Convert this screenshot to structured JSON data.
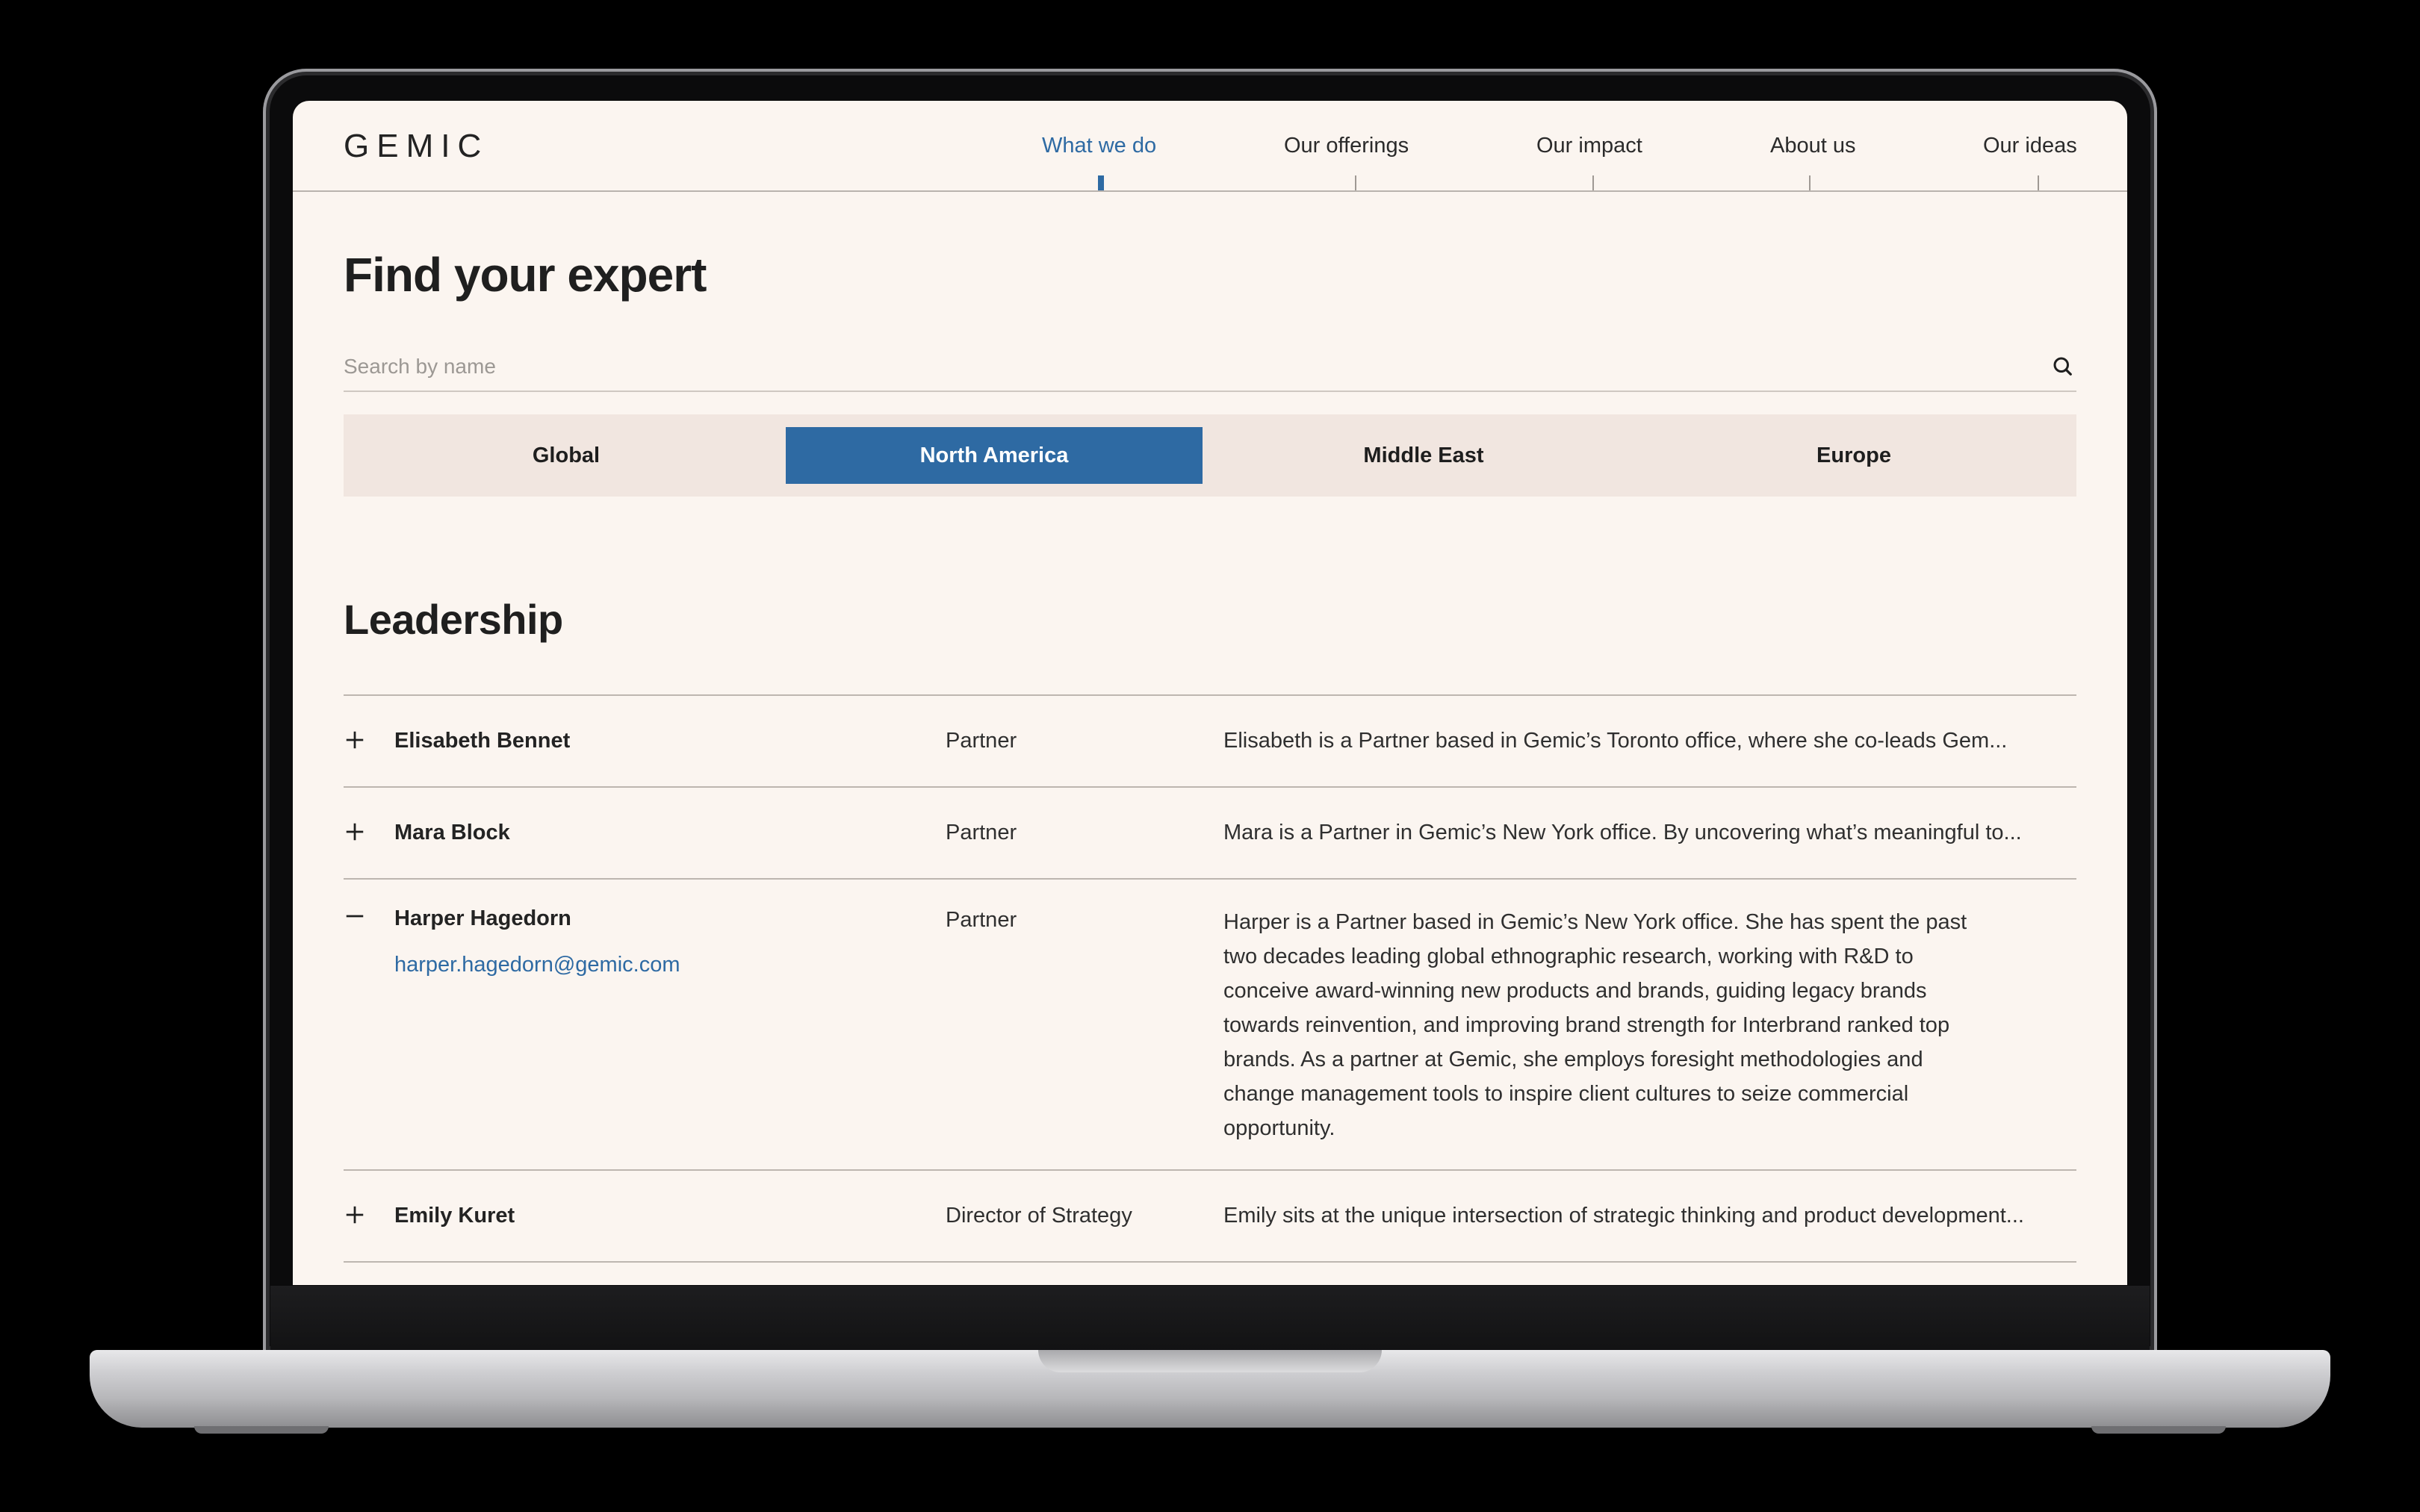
{
  "brand": {
    "logo_text": "GEMIC",
    "accent": "#2e6aa3"
  },
  "nav": {
    "items": [
      {
        "label": "What we do",
        "active": true
      },
      {
        "label": "Our offerings",
        "active": false
      },
      {
        "label": "Our impact",
        "active": false
      },
      {
        "label": "About us",
        "active": false
      },
      {
        "label": "Our ideas",
        "active": false
      }
    ]
  },
  "page": {
    "title": "Find your expert"
  },
  "search": {
    "placeholder": "Search by name",
    "value": "",
    "icon": "search-icon"
  },
  "regions": {
    "tabs": [
      {
        "label": "Global",
        "selected": false
      },
      {
        "label": "North America",
        "selected": true
      },
      {
        "label": "Middle East",
        "selected": false
      },
      {
        "label": "Europe",
        "selected": false
      }
    ]
  },
  "leadership": {
    "title": "Leadership",
    "people": [
      {
        "name": "Elisabeth Bennet",
        "role": "Partner",
        "bio": "Elisabeth is a Partner based in Gemic’s Toronto office, where she co-leads Gem...",
        "expanded": false,
        "toggle_icon": "plus-icon"
      },
      {
        "name": "Mara Block",
        "role": "Partner",
        "bio": "Mara is a Partner in Gemic’s New York office. By uncovering what’s meaningful to...",
        "expanded": false,
        "toggle_icon": "plus-icon"
      },
      {
        "name": "Harper Hagedorn",
        "email": "harper.hagedorn@gemic.com",
        "role": "Partner",
        "bio": "Harper is a Partner based in Gemic’s New York office. She has spent the past two decades leading global ethnographic research, working with R&D to conceive award-winning new products and brands, guiding legacy brands towards reinvention, and improving brand strength for Interbrand ranked top brands. As a partner at Gemic, she employs foresight methodologies and change management tools to inspire client cultures to seize commercial opportunity.",
        "expanded": true,
        "toggle_icon": "minus-icon"
      },
      {
        "name": "Emily Kuret",
        "role": "Director of Strategy",
        "bio": "Emily sits at the unique intersection of strategic thinking and product development...",
        "expanded": false,
        "toggle_icon": "plus-icon"
      }
    ]
  }
}
